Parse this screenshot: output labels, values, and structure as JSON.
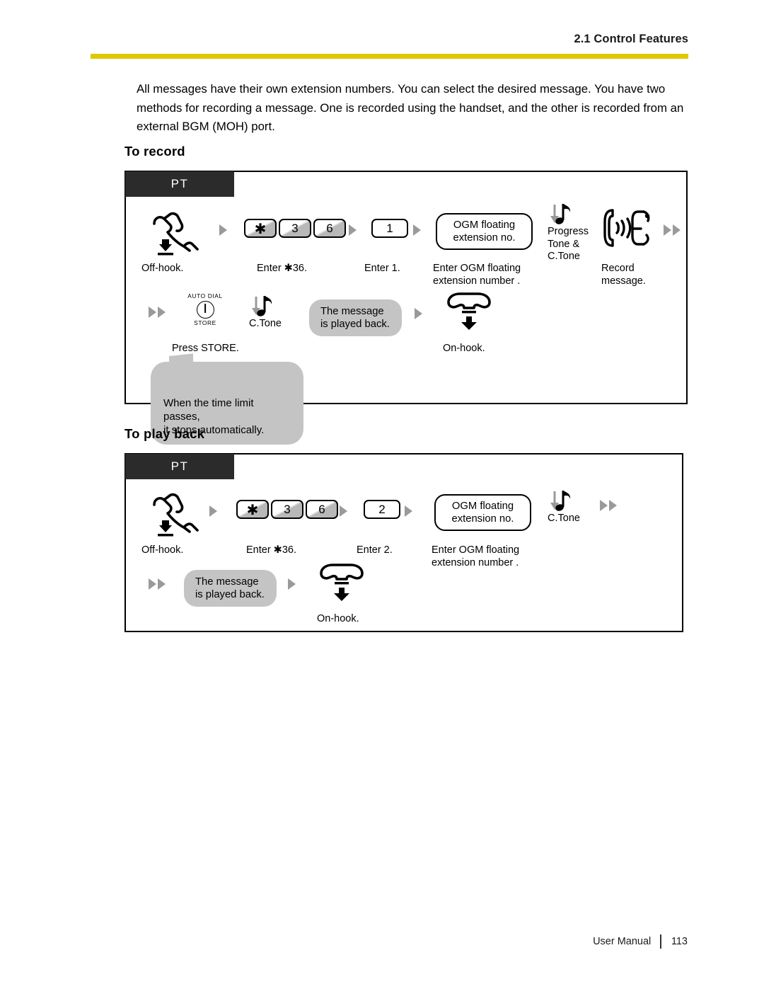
{
  "header": {
    "section_label": "2.1 Control Features",
    "rule_color": "#E0C800"
  },
  "intro": {
    "paragraph": "All messages have their own extension numbers. You can select the desired message. You have two methods for recording a message. One is recorded using the handset, and the other is recorded from an external BGM (MOH) port."
  },
  "sections": [
    {
      "title": "To record",
      "tab_label": "PT",
      "steps": [
        {
          "icon": "off-hook-handset-icon",
          "caption": "Off-hook."
        },
        {
          "icon": "keypad-keys",
          "keys": [
            "✱",
            "3",
            "6"
          ],
          "caption": "Enter ✱36."
        },
        {
          "icon": "keypad-key",
          "keys": [
            "1"
          ],
          "caption": "Enter 1."
        },
        {
          "icon": "pill-callout",
          "pill_text": "OGM floating\nextension no.",
          "caption": "Enter OGM floating\nextension number  ."
        },
        {
          "icon": "music-note-icon",
          "tone_label": "Progress\nTone &\nC.Tone"
        },
        {
          "icon": "record-message-icon",
          "caption": "Record\nmessage."
        },
        {
          "icon": "auto-dial-store-button",
          "button_top": "AUTO DIAL",
          "button_bottom": "STORE",
          "caption": "Press STORE."
        },
        {
          "icon": "music-note-icon",
          "tone_label": "C.Tone"
        },
        {
          "icon": "gray-bubble",
          "bubble_text": "The message\nis played back."
        },
        {
          "icon": "on-hook-handset-icon",
          "caption": "On-hook."
        }
      ],
      "callout": "When the time limit passes,\nit stops automatically."
    },
    {
      "title": "To play back",
      "tab_label": "PT",
      "steps": [
        {
          "icon": "off-hook-handset-icon",
          "caption": "Off-hook."
        },
        {
          "icon": "keypad-keys",
          "keys": [
            "✱",
            "3",
            "6"
          ],
          "caption": "Enter ✱36."
        },
        {
          "icon": "keypad-key",
          "keys": [
            "2"
          ],
          "caption": "Enter 2."
        },
        {
          "icon": "pill-callout",
          "pill_text": "OGM floating\nextension no.",
          "caption": "Enter OGM floating\nextension number  ."
        },
        {
          "icon": "music-note-icon",
          "tone_label": "C.Tone"
        },
        {
          "icon": "gray-bubble",
          "bubble_text": "The message\nis played back."
        },
        {
          "icon": "on-hook-handset-icon",
          "caption": "On-hook."
        }
      ]
    }
  ],
  "footer": {
    "manual_label": "User Manual",
    "page_number": "113"
  }
}
